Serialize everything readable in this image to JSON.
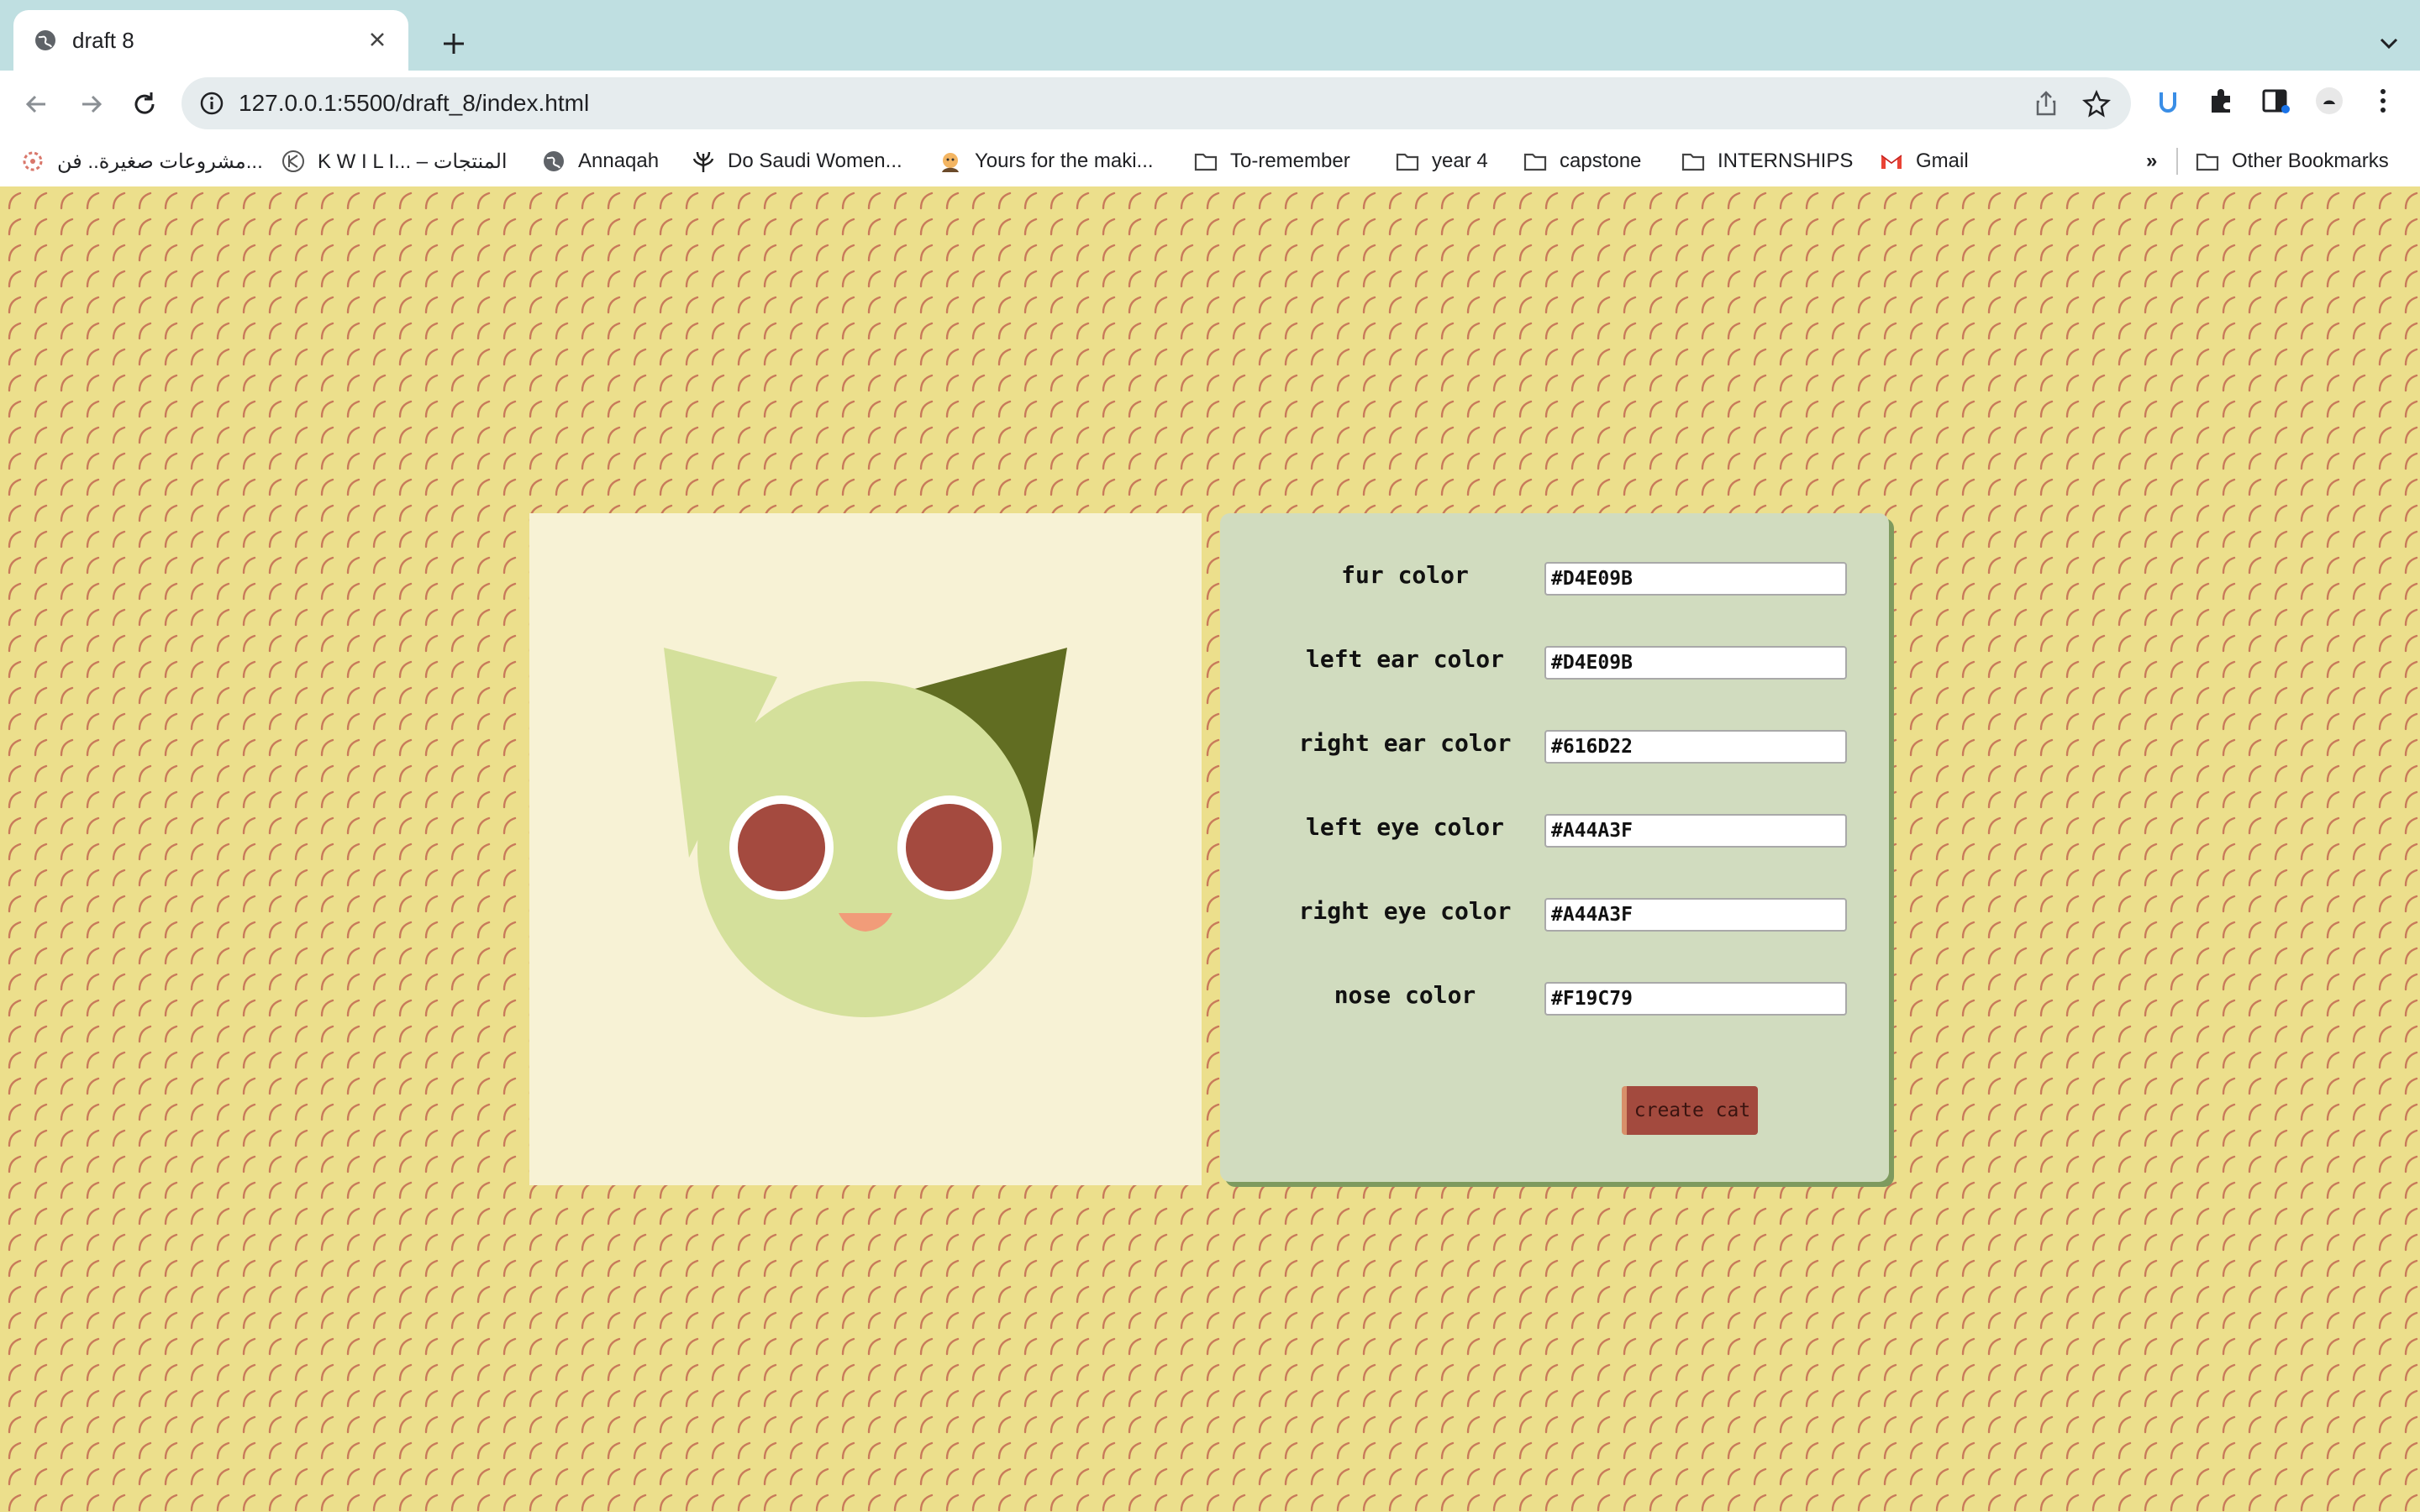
{
  "browser": {
    "tab_title": "draft 8",
    "url": "127.0.0.1:5500/draft_8/index.html",
    "bookmarks": [
      "مشروعات صغيرة.. فن...",
      "K W I L I... – المنتجات",
      "Annaqah",
      "Do Saudi Women...",
      "Yours for the maki...",
      "To-remember",
      "year 4",
      "capstone",
      "INTERNSHIPS",
      "Gmail"
    ],
    "overflow_label": "»",
    "other_bookmarks": "Other Bookmarks"
  },
  "form": {
    "fields": [
      {
        "label": "fur color",
        "value": "#D4E09B"
      },
      {
        "label": "left ear color",
        "value": "#D4E09B"
      },
      {
        "label": "right ear color",
        "value": "#616D22"
      },
      {
        "label": "left eye color",
        "value": "#A44A3F"
      },
      {
        "label": "right eye color",
        "value": "#A44A3F"
      },
      {
        "label": "nose color",
        "value": "#F19C79"
      }
    ],
    "submit_label": "create cat"
  },
  "colors": {
    "page_background": "#ecdf8c",
    "pattern_stroke": "#c87a5a",
    "canvas_background": "#f7f2d5",
    "panel_background": "#d1dcbf",
    "button_color": "#a34a3e"
  },
  "cat": {
    "fur": "#D4E09B",
    "left_ear": "#D4E09B",
    "right_ear": "#616D22",
    "left_eye": "#A44A3F",
    "right_eye": "#A44A3F",
    "nose": "#F19C79"
  }
}
